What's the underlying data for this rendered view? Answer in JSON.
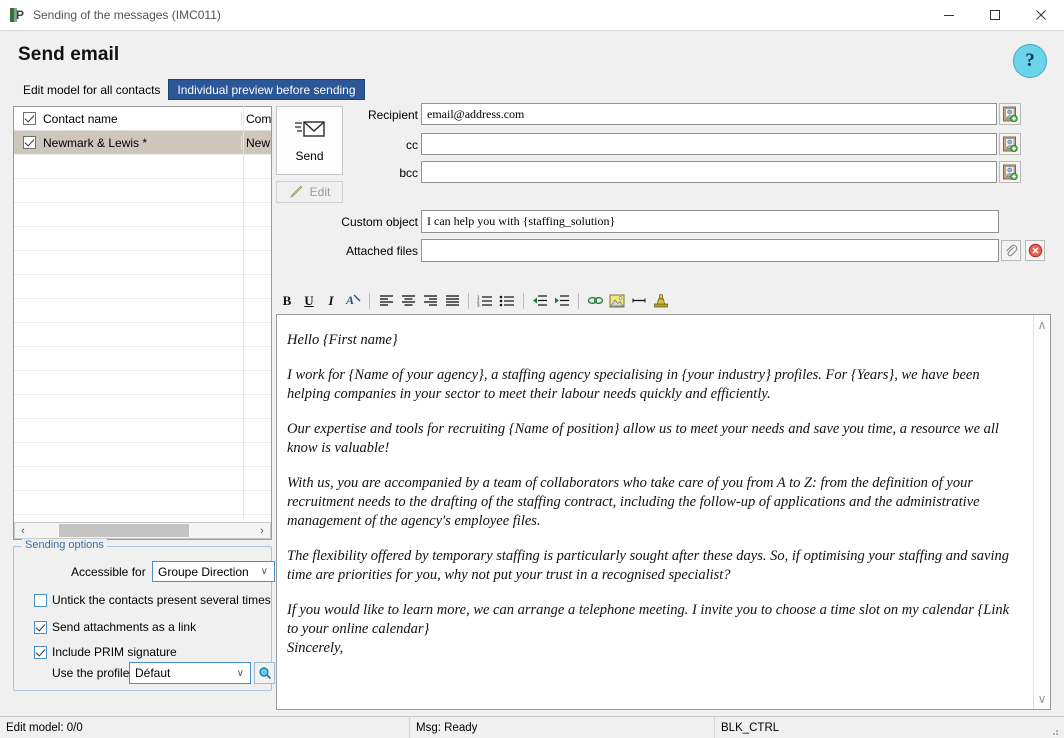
{
  "window": {
    "title": "Sending of the messages (IMC011)",
    "app_icon": "app-icon",
    "minimize": "–",
    "maximize": "□",
    "close": "✕"
  },
  "header": {
    "page_title": "Send email",
    "help_label": "?"
  },
  "tabs": [
    {
      "label": "Edit model for all contacts",
      "active": false
    },
    {
      "label": "Individual preview before sending",
      "active": true
    }
  ],
  "contacts": {
    "columns": [
      "Contact name",
      "Company"
    ],
    "header": {
      "name": "Contact name",
      "company": "Com",
      "checked": true
    },
    "rows": [
      {
        "name": "Newmark & Lewis *",
        "company": "New",
        "checked": true,
        "selected": true
      }
    ],
    "empty_row_count": 15,
    "hscroll": {
      "left_arrow": "‹",
      "right_arrow": "›"
    }
  },
  "actions": {
    "send_label": "Send",
    "send_icon": "envelope-send-icon",
    "edit_label": "Edit",
    "edit_icon": "pencil-icon",
    "edit_disabled": true
  },
  "mail": {
    "recipient": {
      "label": "Recipient",
      "value": "email@address.com",
      "picker_icon": "address-book-icon"
    },
    "cc": {
      "label": "cc",
      "value": "",
      "picker_icon": "address-book-icon"
    },
    "bcc": {
      "label": "bcc",
      "value": "",
      "picker_icon": "address-book-icon"
    },
    "custom_object": {
      "label": "Custom object",
      "value": "I can help you with {staffing_solution}"
    },
    "attached_files": {
      "label": "Attached files",
      "value": "",
      "attach_icon": "paperclip-icon",
      "delete_icon": "delete-red-x-icon"
    }
  },
  "toolbar": {
    "items": [
      {
        "name": "bold-icon",
        "glyph": "B"
      },
      {
        "name": "underline-icon",
        "glyph": "U"
      },
      {
        "name": "italic-icon",
        "glyph": "I"
      },
      {
        "name": "font-color-icon",
        "glyph": "A"
      },
      {
        "name": "align-left-icon",
        "glyph": "≡"
      },
      {
        "name": "align-center-icon",
        "glyph": "≡"
      },
      {
        "name": "align-right-icon",
        "glyph": "≡"
      },
      {
        "name": "align-justify-icon",
        "glyph": "≡"
      },
      {
        "name": "numbered-list-icon",
        "glyph": "☰"
      },
      {
        "name": "bullet-list-icon",
        "glyph": "☰"
      },
      {
        "name": "decrease-indent-icon",
        "glyph": "⇤"
      },
      {
        "name": "increase-indent-icon",
        "glyph": "⇥"
      },
      {
        "name": "insert-link-icon",
        "glyph": "⚭"
      },
      {
        "name": "insert-image-icon",
        "glyph": "Ὓc"
      },
      {
        "name": "horizontal-rule-icon",
        "glyph": "—"
      },
      {
        "name": "signature-stamp-icon",
        "glyph": "♟"
      }
    ]
  },
  "body": {
    "paragraphs": [
      "Hello {First name}",
      "I work for {Name of your agency}, a staffing agency specialising in {your industry} profiles. For {Years}, we have been helping companies in your sector to meet their labour needs quickly and efficiently.",
      "Our expertise and tools for recruiting {Name of position} allow us to meet your needs and save you time, a resource we all know is valuable!",
      "With us, you are accompanied by a team of collaborators who take care of you from A to Z: from the definition of your recruitment needs to the drafting of the staffing contract, including the follow-up of applications and the administrative management of the agency's employee files.",
      "The flexibility offered by temporary staffing is particularly sought after these days. So, if optimising your staffing and saving time are priorities for you, why not put your trust in a recognised specialist?",
      "If you would like to learn more, we can arrange a telephone meeting. I invite you to choose a time slot on my calendar {Link to your online calendar}",
      "Sincerely,"
    ],
    "scroll_up": "∧",
    "scroll_down": "∨"
  },
  "sending_options": {
    "legend": "Sending options",
    "accessible_for": {
      "label": "Accessible for",
      "value": "Groupe Direction",
      "caret": "∨"
    },
    "checkboxes": [
      {
        "label": "Untick the contacts present several times",
        "checked": false
      },
      {
        "label": "Send attachments as a link",
        "checked": true
      },
      {
        "label": "Include PRIM signature",
        "checked": true
      }
    ],
    "profile": {
      "label": "Use the profile",
      "value": "Défaut",
      "caret": "∨",
      "search_icon": "magnifier-icon"
    }
  },
  "statusbar": {
    "left": "Edit model: 0/0",
    "middle": "Msg: Ready",
    "right": "BLK_CTRL"
  },
  "colors": {
    "tab_active_bg": "#2b5797",
    "help_bg": "#6ad4ea",
    "selection_bg": "#cdc7bb",
    "field_border": "#919191",
    "group_border": "#a9c3e0"
  }
}
